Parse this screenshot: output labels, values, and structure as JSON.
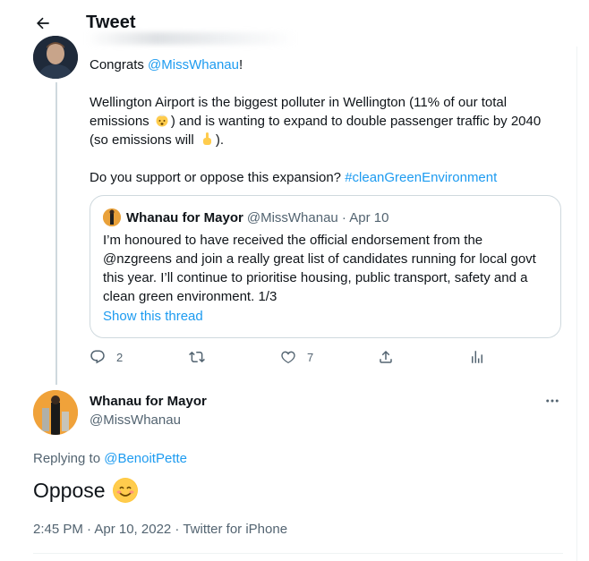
{
  "header": {
    "back_icon": "arrow-left-icon",
    "title": "Tweet"
  },
  "parent_tweet": {
    "line1_pre": "Congrats ",
    "line1_mention": "@MissWhanau",
    "line1_post": "!",
    "para2_a": "Wellington Airport is the biggest polluter in Wellington (11% of our total emissions ",
    "para2_emoji1": "exploding-head-emoji",
    "para2_b": ") and is wanting to expand to double passenger traffic by 2040 (so emissions will ",
    "para2_emoji2": "pointing-up-emoji",
    "para2_c": ").",
    "para3_pre": "Do you support or oppose this expansion? ",
    "para3_hashtag": "#cleanGreenEnvironment",
    "quote": {
      "name": "Whanau for Mayor",
      "meta": "@MissWhanau · Apr 10",
      "text": "I’m honoured to have received the official endorsement from the @nzgreens and join a really great list of candidates running for local govt this year. I’ll continue to prioritise housing, public transport, safety and a clean green environment. 1/3",
      "show_thread": "Show this thread"
    },
    "actions": {
      "reply_icon": "reply-icon",
      "reply_count": "2",
      "retweet_icon": "retweet-icon",
      "like_icon": "heart-icon",
      "like_count": "7",
      "share_icon": "share-icon",
      "analytics_icon": "analytics-icon"
    }
  },
  "main_tweet": {
    "name": "Whanau for Mayor",
    "handle": "@MissWhanau",
    "more_icon": "more-icon",
    "replying_pre": "Replying to ",
    "replying_to": "@BenoitPette",
    "text": "Oppose",
    "emoji": "smiling-face-emoji",
    "timestamp": "2:45 PM · Apr 10, 2022 · Twitter for iPhone"
  },
  "colors": {
    "link": "#1d9bf0",
    "secondary_text": "#536471",
    "border": "#cfd9de"
  }
}
